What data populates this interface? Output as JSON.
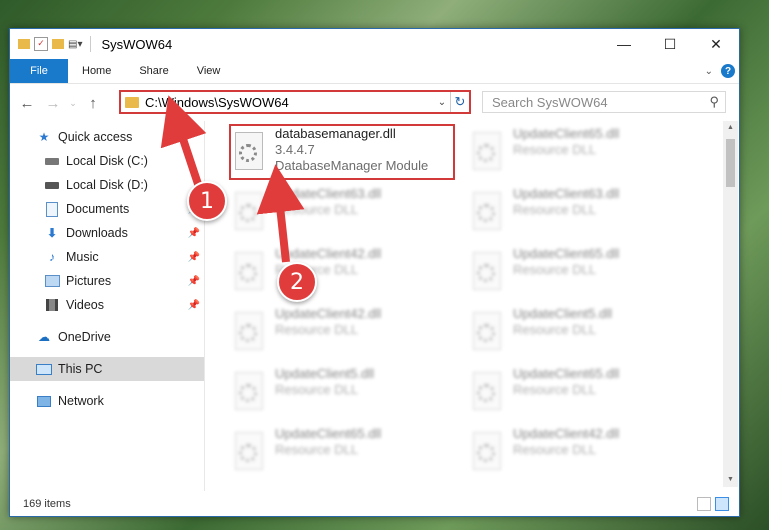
{
  "window": {
    "title": "SysWOW64"
  },
  "ribbon": {
    "tabs": [
      "File",
      "Home",
      "Share",
      "View"
    ],
    "help": "?"
  },
  "address": {
    "path": "C:\\Windows\\SysWOW64"
  },
  "search": {
    "placeholder": "Search SysWOW64"
  },
  "sidebar": {
    "items": [
      {
        "label": "Quick access",
        "icon": "star-icon"
      },
      {
        "label": "Local Disk (C:)",
        "icon": "disk-icon"
      },
      {
        "label": "Local Disk (D:)",
        "icon": "disk-icon"
      },
      {
        "label": "Documents",
        "icon": "documents-icon"
      },
      {
        "label": "Downloads",
        "icon": "downloads-icon"
      },
      {
        "label": "Music",
        "icon": "music-icon"
      },
      {
        "label": "Pictures",
        "icon": "pictures-icon"
      },
      {
        "label": "Videos",
        "icon": "videos-icon"
      },
      {
        "label": "OneDrive",
        "icon": "onedrive-icon"
      },
      {
        "label": "This PC",
        "icon": "computer-icon"
      },
      {
        "label": "Network",
        "icon": "network-icon"
      }
    ]
  },
  "files": [
    {
      "name": "databasemanager.dll",
      "version": "3.4.4.7",
      "desc": "DatabaseManager Module"
    },
    {
      "name": "UpdateClient65.dll",
      "desc": "Resource DLL"
    },
    {
      "name": "UpdateClient63.dll",
      "desc": "Resource DLL"
    },
    {
      "name": "UpdateClient63.dll",
      "desc": "Resource DLL"
    },
    {
      "name": "UpdateClient42.dll",
      "desc": "Resource DLL"
    },
    {
      "name": "UpdateClient65.dll",
      "desc": "Resource DLL"
    },
    {
      "name": "UpdateClient42.dll",
      "desc": "Resource DLL"
    },
    {
      "name": "UpdateClient5.dll",
      "desc": "Resource DLL"
    },
    {
      "name": "UpdateClient5.dll",
      "desc": "Resource DLL"
    },
    {
      "name": "UpdateClient65.dll",
      "desc": "Resource DLL"
    },
    {
      "name": "UpdateClient65.dll",
      "desc": "Resource DLL"
    },
    {
      "name": "UpdateClient42.dll",
      "desc": "Resource DLL"
    }
  ],
  "status": {
    "count": "169 items"
  },
  "annotations": {
    "badge1": "1",
    "badge2": "2",
    "color": "#e03c3c"
  }
}
